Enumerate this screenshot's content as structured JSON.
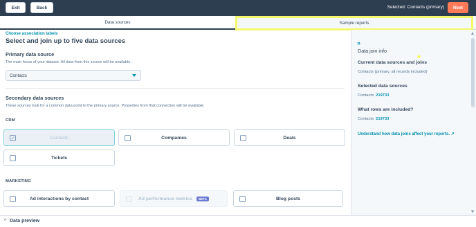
{
  "topbar": {
    "exit_label": "Exit",
    "back_label": "Back",
    "selected_text": "Selected: Contacts (primary)",
    "next_label": "Next"
  },
  "tabs": [
    {
      "label": "Data sources",
      "active": true
    },
    {
      "label": "Sample reports",
      "active": false
    }
  ],
  "main": {
    "association_link": "Choose association labels",
    "title": "Select and join up to five data sources",
    "primary": {
      "heading": "Primary data source",
      "description": "The main focus of your dataset. All data from this source will be available.",
      "selected_value": "Contacts"
    },
    "secondary": {
      "heading": "Secondary data sources",
      "description": "These sources look for a common data point to the primary source. Properties from that connection will be available."
    },
    "groups": {
      "crm": {
        "label": "CRM",
        "items": [
          "Contacts",
          "Companies",
          "Deals",
          "Tickets"
        ]
      },
      "marketing": {
        "label": "MARKETING",
        "items": [
          "Ad interactions by contact",
          "Ad performance metrics",
          "Blog posts"
        ],
        "beta_label": "BETA"
      }
    }
  },
  "sidebar": {
    "title": "Data join info",
    "current_heading": "Current data sources and joins",
    "current_text": "Contacts (primary, all records included)",
    "selected_heading": "Selected data sources",
    "selected_prefix": "Contacts:",
    "selected_count": "219733",
    "rows_heading": "What rows are included?",
    "rows_prefix": "Contacts:",
    "rows_count": "219733",
    "link": "Understand how data joins affect your reports."
  },
  "bottom": {
    "label": "Data preview"
  },
  "colors": {
    "topbar": "#2d3e50",
    "accent": "#ff7a59",
    "link": "#0091ae",
    "highlight": "#f4f86a"
  }
}
